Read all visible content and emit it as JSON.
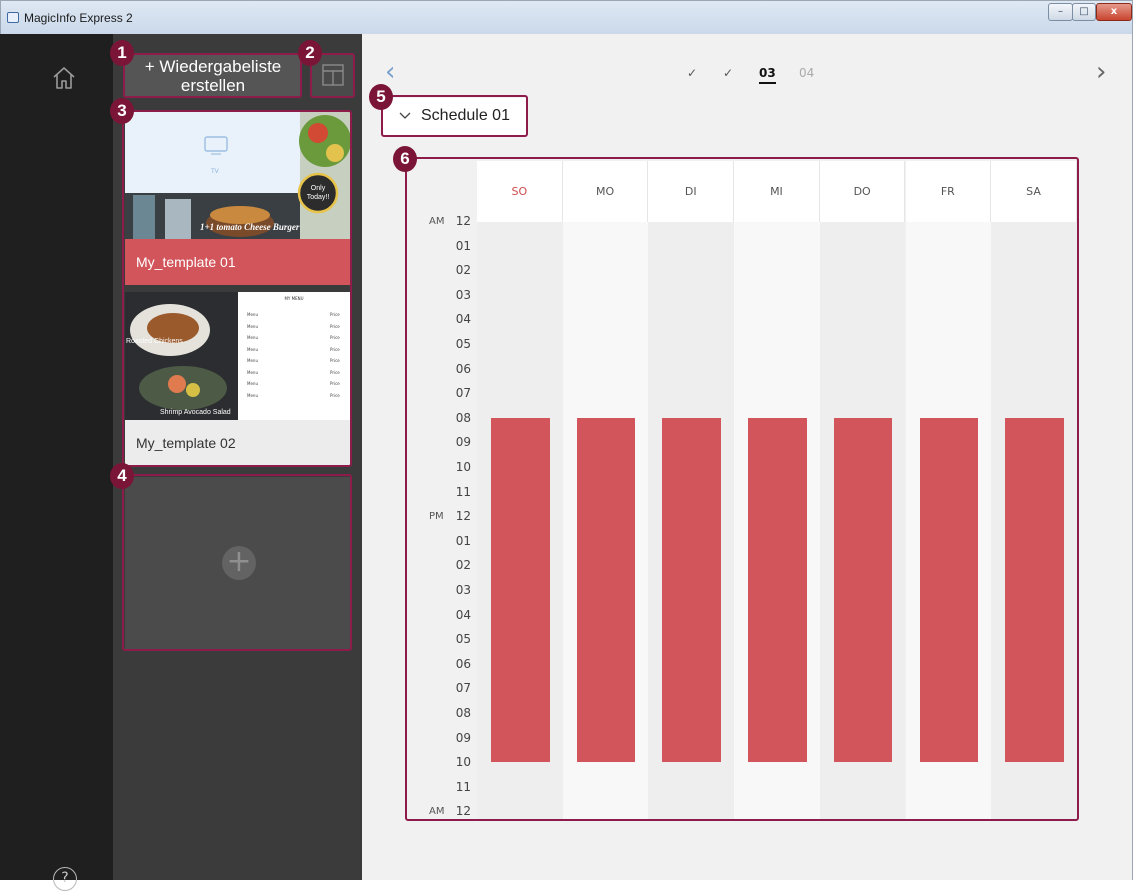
{
  "window": {
    "title": "MagicInfo Express 2",
    "min": "–",
    "max": "□",
    "close": "x"
  },
  "sidebar": {
    "help": "?"
  },
  "panel": {
    "create_button": "+ Wiedergabeliste erstellen",
    "templates": [
      {
        "name": "My_template 01",
        "thumb": {
          "tv_caption": "TV",
          "promo": "Only Today!!",
          "headline": "1+1 tomato Cheese Burger"
        }
      },
      {
        "name": "My_template 02",
        "thumb": {
          "menu_title": "MY MENU",
          "caption1": "Roasted Chickens",
          "caption2": "Shrimp Avocado Salad",
          "menu_items": [
            "Menu",
            "Menu",
            "Menu",
            "Menu",
            "Menu",
            "Menu",
            "Menu",
            "Menu"
          ],
          "prices": [
            "Price",
            "Price",
            "Price",
            "Price",
            "Price",
            "Price",
            "Price",
            "Price"
          ]
        }
      }
    ],
    "add_template": "+"
  },
  "badges": [
    "1",
    "2",
    "3",
    "4",
    "5",
    "6"
  ],
  "steps": {
    "step1": "✓",
    "step2": "✓",
    "step3": "03",
    "step4": "04",
    "prev": "‹",
    "next": "›"
  },
  "schedule": {
    "dropdown_label": "Schedule 01",
    "days": [
      "SO",
      "MO",
      "DI",
      "MI",
      "DO",
      "FR",
      "SA"
    ],
    "hours": [
      "12",
      "01",
      "02",
      "03",
      "04",
      "05",
      "06",
      "07",
      "08",
      "09",
      "10",
      "11",
      "12",
      "01",
      "02",
      "03",
      "04",
      "05",
      "06",
      "07",
      "08",
      "09",
      "10",
      "11",
      "12"
    ],
    "ampm": [
      "AM",
      "PM",
      "AM"
    ],
    "active_start_hour": 8,
    "active_end_hour": 22
  },
  "colors": {
    "accent": "#d1555b",
    "highlight": "#8e1c4a",
    "badge": "#7b1537"
  }
}
